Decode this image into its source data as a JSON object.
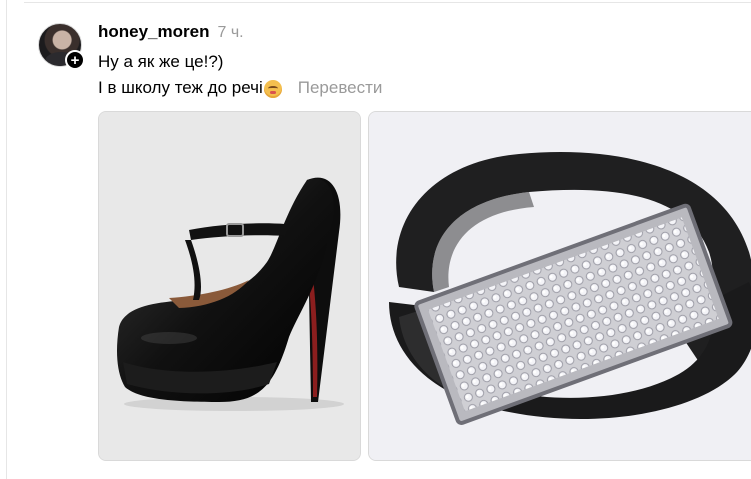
{
  "post": {
    "username": "honey_moren",
    "time": "7 ч.",
    "lines": [
      "Ну а як же це!?)",
      "І в школу теж до речі"
    ],
    "translate_label": "Перевести",
    "follow_symbol": "+"
  },
  "media": [
    {
      "name": "black platform high heel"
    },
    {
      "name": "black belt with crystal buckle"
    }
  ],
  "colors": {
    "muted_text": "#9a9a9a",
    "divider": "#e6e6e6"
  }
}
